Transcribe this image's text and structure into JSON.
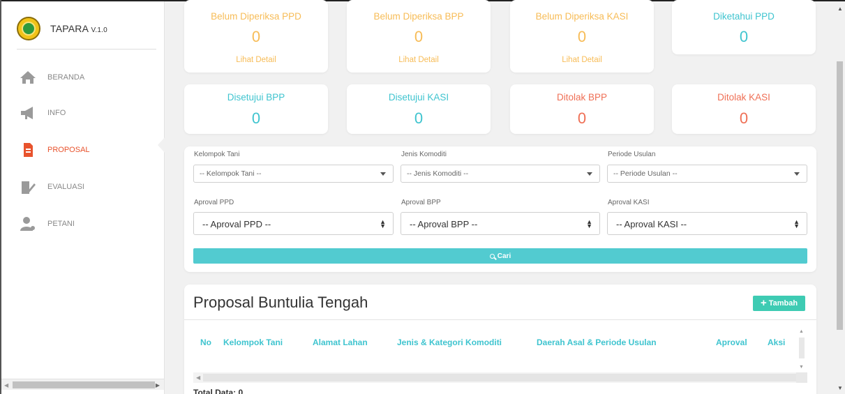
{
  "brand": {
    "name": "TAPARA",
    "version": "V.1.0"
  },
  "sidebar": {
    "items": [
      {
        "label": "BERANDA",
        "icon": "home-icon",
        "active": false
      },
      {
        "label": "INFO",
        "icon": "megaphone-icon",
        "active": false
      },
      {
        "label": "PROPOSAL",
        "icon": "document-icon",
        "active": true
      },
      {
        "label": "EVALUASI",
        "icon": "evaluation-icon",
        "active": false
      },
      {
        "label": "PETANI",
        "icon": "farmer-icon",
        "active": false
      }
    ]
  },
  "stats_row1": [
    {
      "title": "Belum Diperiksa PPD",
      "value": "0",
      "link": "Lihat Detail",
      "color": "#f7bc57"
    },
    {
      "title": "Belum Diperiksa BPP",
      "value": "0",
      "link": "Lihat Detail",
      "color": "#f7bc57"
    },
    {
      "title": "Belum Diperiksa KASI",
      "value": "0",
      "link": "Lihat Detail",
      "color": "#f7bc57"
    },
    {
      "title": "Diketahui PPD",
      "value": "0",
      "color": "#3fc4cf"
    }
  ],
  "stats_row2": [
    {
      "title": "Disetujui BPP",
      "value": "0",
      "color": "#3fc4cf"
    },
    {
      "title": "Disetujui KASI",
      "value": "0",
      "color": "#3fc4cf"
    },
    {
      "title": "Ditolak BPP",
      "value": "0",
      "color": "#ef6f55"
    },
    {
      "title": "Ditolak KASI",
      "value": "0",
      "color": "#ef6f55"
    }
  ],
  "filters": {
    "kelompok_tani": {
      "label": "Kelompok Tani",
      "value": "-- Kelompok Tani --"
    },
    "jenis_komoditi": {
      "label": "Jenis Komoditi",
      "value": "-- Jenis Komoditi --"
    },
    "periode_usulan": {
      "label": "Periode Usulan",
      "value": "-- Periode Usulan --"
    },
    "aproval_ppd": {
      "label": "Aproval PPD",
      "value": "-- Aproval PPD --"
    },
    "aproval_bpp": {
      "label": "Aproval BPP",
      "value": "-- Aproval BPP --"
    },
    "aproval_kasi": {
      "label": "Aproval KASI",
      "value": "-- Aproval KASI --"
    },
    "search_label": "Cari"
  },
  "section": {
    "title": "Proposal Buntulia Tengah",
    "add_label": "Tambah"
  },
  "table": {
    "headers": [
      "No",
      "Kelompok Tani",
      "Alamat Lahan",
      "Jenis & Kategori Komoditi",
      "Daerah Asal & Periode Usulan",
      "Aproval",
      "Aksi"
    ],
    "rows": []
  },
  "footer": {
    "total": "Total Data: 0"
  },
  "colors": {
    "accent": "#52cbd0",
    "add": "#3ecbb3",
    "warning": "#f7bc57",
    "danger": "#ef6f55",
    "info": "#3fc4cf",
    "active_nav": "#e8532d"
  }
}
